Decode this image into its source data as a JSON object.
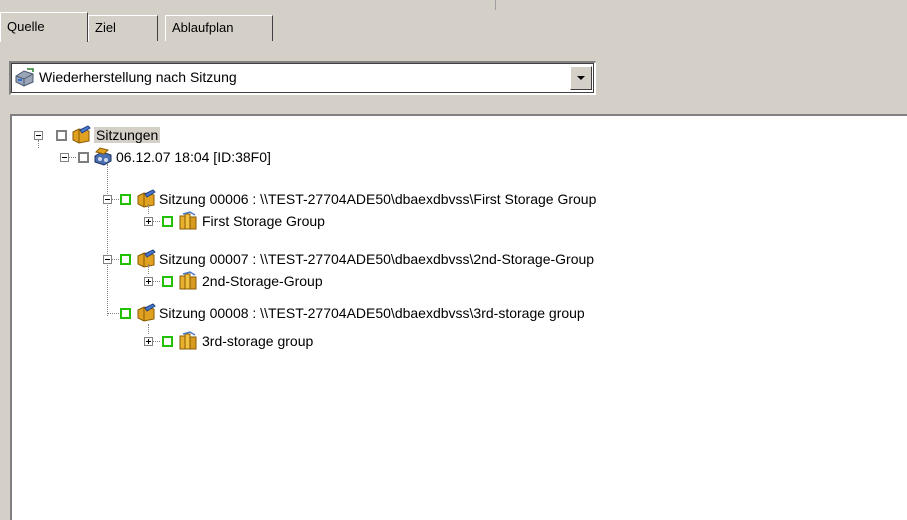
{
  "tabs": [
    {
      "label": "Quelle",
      "active": true
    },
    {
      "label": "Ziel",
      "active": false
    },
    {
      "label": "Ablaufplan",
      "active": false
    }
  ],
  "dropdown": {
    "selected": "Wiederherstellung nach Sitzung",
    "icon": "restore-drive-icon"
  },
  "tree": {
    "root": {
      "label": "Sitzungen",
      "icon": "sessions-folder-icon"
    },
    "tape": {
      "label": "06.12.07 18:04 [ID:38F0]",
      "icon": "tape-media-icon"
    },
    "sessions": [
      {
        "label": "Sitzung 00006 : \\\\TEST-27704ADE50\\dbaexdbvss\\First Storage Group",
        "child": "First Storage Group"
      },
      {
        "label": "Sitzung 00007 : \\\\TEST-27704ADE50\\dbaexdbvss\\2nd-Storage-Group",
        "child": "2nd-Storage-Group"
      },
      {
        "label": "Sitzung 00008 : \\\\TEST-27704ADE50\\dbaexdbvss\\3rd-storage group",
        "child": "3rd-storage group"
      }
    ]
  },
  "colors": {
    "check_green": "#21c000",
    "check_gray": "#7f7f7f",
    "panel_bg": "#d4d0c8"
  }
}
